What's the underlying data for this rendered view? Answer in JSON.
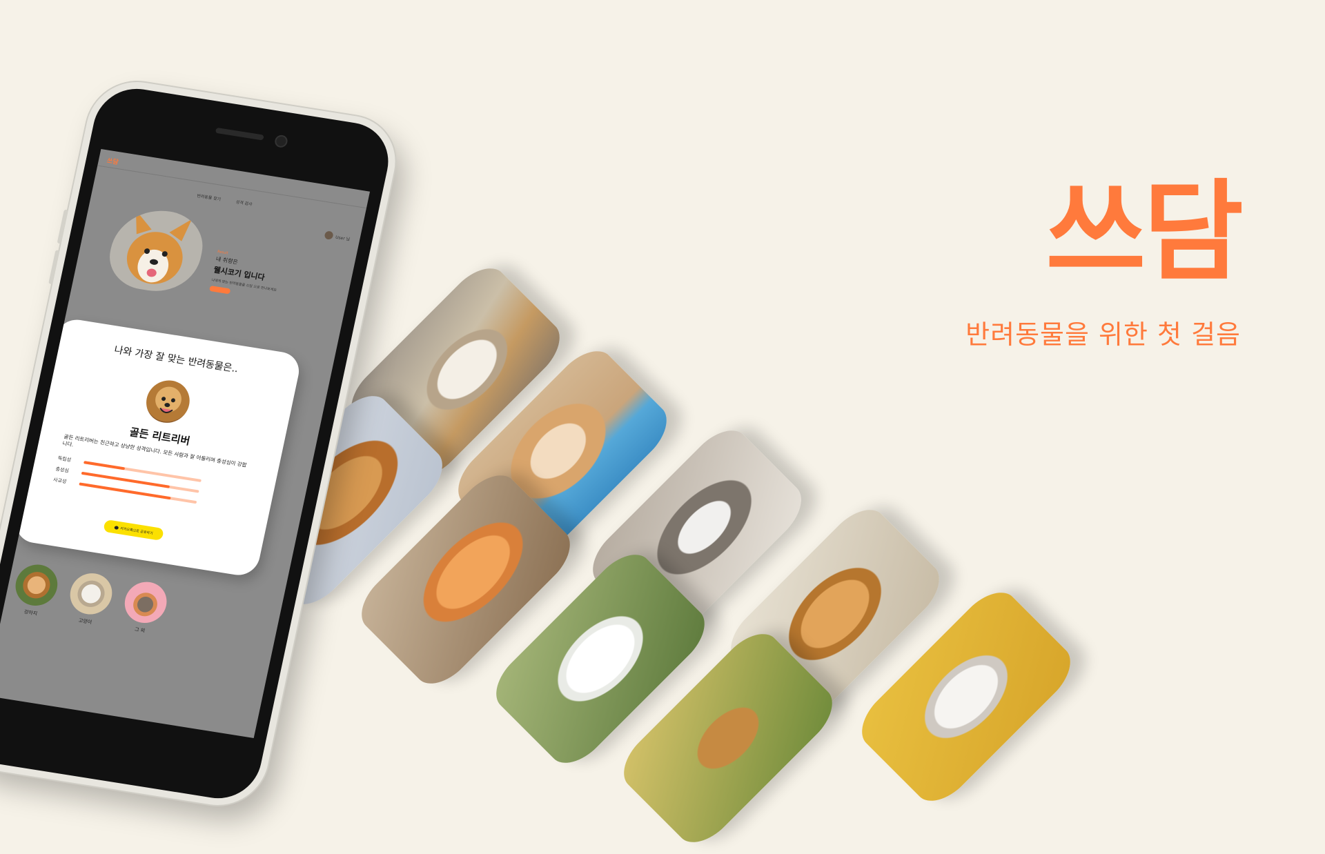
{
  "brand": {
    "title": "쓰담",
    "subtitle": "반려동물을 위한 첫 걸음",
    "accent": "#ff7a3c"
  },
  "app": {
    "logo": "쓰담",
    "nav": [
      "반려동물 찾기",
      "성격 검사"
    ],
    "user": "User 님",
    "hero": {
      "tag": "Result",
      "line1": "내 취향은",
      "line2": "웰시코기 입니다",
      "desc": "나에게 맞는 반려동물을 쓰담 으로 만나보세요",
      "button": "더보기"
    },
    "modal": {
      "title": "나와 가장 잘 맞는 반려동물은..",
      "result_name": "골든 리트리버",
      "description": "골든 리트리버는 친근하고 상냥한 성격입니다. 모든 사람과 잘 어울리며 충성심이 강합니다.",
      "traits": [
        {
          "label": "독립성",
          "value": 0.35
        },
        {
          "label": "충성심",
          "value": 0.75
        },
        {
          "label": "사교성",
          "value": 0.78
        }
      ],
      "share_button": "카카오톡으로 공유하기"
    },
    "categories": [
      {
        "label": "강아지"
      },
      {
        "label": "고양이"
      },
      {
        "label": "그 외"
      }
    ]
  },
  "tiles": [
    {
      "icon": "cat-in-box-photo"
    },
    {
      "icon": "corgi-ear-photo"
    },
    {
      "icon": "shiba-puppy-photo"
    },
    {
      "icon": "orange-cat-photo"
    },
    {
      "icon": "tabby-cat-photo"
    },
    {
      "icon": "white-puppy-photo"
    },
    {
      "icon": "golden-puppy-photo"
    },
    {
      "icon": "yellow-puppy-photo"
    },
    {
      "icon": "white-kitten-photo"
    }
  ]
}
